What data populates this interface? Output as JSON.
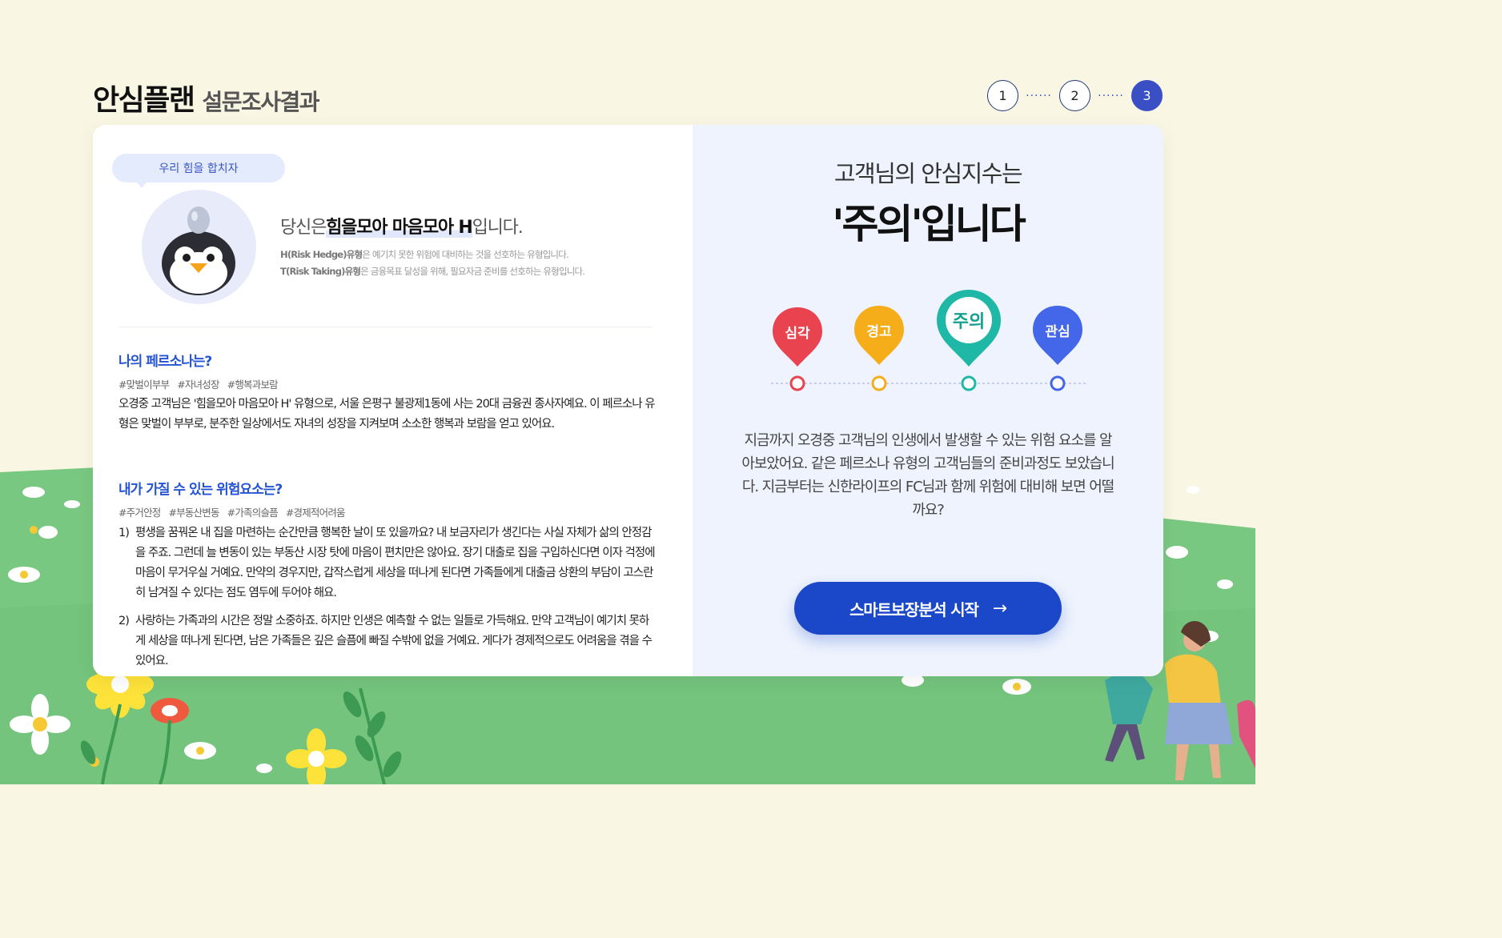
{
  "header": {
    "title_main": "안심플랜",
    "title_sub": "설문조사결과"
  },
  "steps": [
    "1",
    "2",
    "3"
  ],
  "steps_active": 3,
  "persona": {
    "bubble": "우리 힘을 합치자",
    "title_prefix": "당신은",
    "title_highlight": "힘을모아 마음모아 H",
    "title_suffix": "입니다.",
    "desc_h_label": "H(Risk Hedge)유형",
    "desc_h_text": "은 예기치 못한 위험에 대비하는 것을 선호하는 유형입니다.",
    "desc_t_label": "T(Risk Taking)유형",
    "desc_t_text": "은 금융목표 달성을 위해, 필요자금 준비를 선호하는 유형입니다."
  },
  "my_persona": {
    "title": "나의 페르소나는?",
    "tags": [
      "#맞벌이부부",
      "#자녀성장",
      "#행복과보람"
    ],
    "text": "오경중 고객님은 '힘을모아 마음모아 H' 유형으로, 서울 은평구 불광제1동에 사는 20대 금융권 종사자예요. 이 페르소나 유형은 맞벌이 부부로, 분주한 일상에서도 자녀의 성장을 지켜보며 소소한 행복과 보람을 얻고 있어요."
  },
  "risks": {
    "title": "내가 가질 수 있는 위험요소는?",
    "tags": [
      "#주거안정",
      "#부동산변동",
      "#가족의슬픔",
      "#경제적어려움"
    ],
    "items": [
      {
        "num": "1)",
        "text": "평생을 꿈꿔온 내 집을 마련하는 순간만큼 행복한 날이 또 있을까요? 내 보금자리가 생긴다는 사실 자체가 삶의 안정감을 주죠. 그런데 늘 변동이 있는 부동산 시장 탓에 마음이 편치만은 않아요. 장기 대출로 집을 구입하신다면 이자 걱정에 마음이 무거우실 거예요. 만약의 경우지만, 갑작스럽게 세상을 떠나게 된다면 가족들에게 대출금 상환의 부담이 고스란히 남겨질 수 있다는 점도 염두에 두어야 해요."
      },
      {
        "num": "2)",
        "text": "사랑하는 가족과의 시간은 정말 소중하죠. 하지만 인생은 예측할 수 없는 일들로 가득해요. 만약 고객님이 예기치 못하게 세상을 떠나게 된다면, 남은 가족들은 깊은 슬픔에 빠질 수밖에 없을 거예요. 게다가 경제적으로도 어려움을 겪을 수 있어요."
      }
    ]
  },
  "result": {
    "lead": "고객님의 안심지수는",
    "headline": "'주의'입니다",
    "levels": [
      {
        "label": "심각",
        "color": "#e8434f"
      },
      {
        "label": "경고",
        "color": "#f6ad1a"
      },
      {
        "label": "주의",
        "color": "#1fb7a6"
      },
      {
        "label": "관심",
        "color": "#4466e8"
      }
    ],
    "current_level": "주의",
    "body": "지금까지 오경중 고객님의 인생에서 발생할 수 있는 위험 요소를 알아보았어요. 같은 페르소나 유형의 고객님들의 준비과정도 보았습니다. 지금부터는 신한라이프의 FC님과 함께 위험에 대비해 보면 어떨까요?",
    "cta": "스마트보장분석 시작",
    "cta_arrow": "→"
  },
  "colors": {
    "background": "#faf6e4",
    "grass": "#79c882",
    "accent": "#1a48c9",
    "highlight_text": "#2453d4",
    "right_panel": "#eef3fd"
  }
}
